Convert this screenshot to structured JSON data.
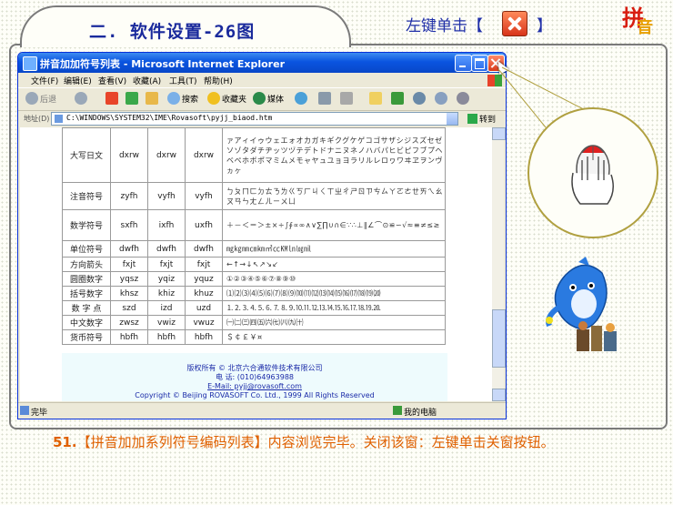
{
  "header": {
    "title": "二. 软件设置-26图",
    "hint_prefix": "左键单击【",
    "hint_suffix": "】",
    "logo_char_1": "拼",
    "logo_char_2": "音"
  },
  "browser": {
    "title": "拼音加加符号列表 - Microsoft Internet Explorer",
    "menu": [
      "文件(F)",
      "编辑(E)",
      "查看(V)",
      "收藏(A)",
      "工具(T)",
      "帮助(H)"
    ],
    "toolbar": {
      "back": "后退",
      "search": "搜索",
      "favorites": "收藏夹",
      "media": "媒体"
    },
    "address_label": "地址(D)",
    "address_value": "C:\\WINDOWS\\SYSTEM32\\IME\\Rovasoft\\pyjj_biaod.htm",
    "go_label": "转到",
    "status_text": "完毕",
    "status_zone": "我的电脑"
  },
  "table": {
    "rows": [
      {
        "name": "大写日文",
        "c1": "dxrw",
        "c2": "dxrw",
        "c3": "dxrw",
        "sym": "ァアィイゥウェエォオカガキギクグケゲコゴサザシジスズセゼソゾタダチヂッツヅテデトドナニヌネノハバパヒビピフブプヘベペホボポマミムメモャヤュユョヨラリルレロヮワヰヱヲンヴヵヶ"
      },
      {
        "name": "注音符号",
        "c1": "zyfh",
        "c2": "vyfh",
        "c3": "vyfh",
        "sym": "ㄅㄆㄇㄈㄉㄊㄋㄌㄍㄎㄏㄐㄑㄒㄓㄔㄕㄖㄗㄘㄙㄚㄛㄜㄝㄞㄟㄠㄡㄢㄣㄤㄥㄦㄧㄨㄩ"
      },
      {
        "name": "数学符号",
        "c1": "sxfh",
        "c2": "ixfh",
        "c3": "uxfh",
        "sym": "＋－＜＝＞±×÷∫∮∝∞∧∨∑∏∪∩∈∵∴⊥∥∠⌒⊙≌∽√≈≡≠≤≥"
      },
      {
        "name": "单位符号",
        "c1": "dwfh",
        "c2": "dwfh",
        "c3": "dwfh",
        "sym": "㎎㎏㎜㎝㎞㎡㏄㏎㏑㏒㏕"
      },
      {
        "name": "方向箭头",
        "c1": "fxjt",
        "c2": "fxjt",
        "c3": "fxjt",
        "sym": "←↑→↓↖↗↘↙"
      },
      {
        "name": "圆圈数字",
        "c1": "yqsz",
        "c2": "yqiz",
        "c3": "yquz",
        "sym": "①②③④⑤⑥⑦⑧⑨⑩"
      },
      {
        "name": "括号数字",
        "c1": "khsz",
        "c2": "khiz",
        "c3": "khuz",
        "sym": "⑴⑵⑶⑷⑸⑹⑺⑻⑼⑽⑾⑿⒀⒁⒂⒃⒄⒅⒆⒇"
      },
      {
        "name": "数 字 点",
        "c1": "szd",
        "c2": "izd",
        "c3": "uzd",
        "sym": "⒈⒉⒊⒋⒌⒍⒎⒏⒐⒑⒒⒓⒔⒕⒖⒗⒘⒙⒚⒛"
      },
      {
        "name": "中文数字",
        "c1": "zwsz",
        "c2": "vwiz",
        "c3": "vwuz",
        "sym": "㈠㈡㈢㈣㈤㈥㈦㈧㈨㈩"
      },
      {
        "name": "货币符号",
        "c1": "hbfh",
        "c2": "hbfh",
        "c3": "hbfh",
        "sym": "＄￠￡￥¤"
      }
    ]
  },
  "footer": {
    "line1": "版权所有 © 北京六合通软件技术有限公司",
    "line2": "电  话: (010)64963988",
    "line3": "E-Mail: pyjj@rovasoft.com",
    "line4": "Copyright © Beijing ROVASOFT Co. Ltd., 1999  All Rights Reserved"
  },
  "caption": {
    "number": "51.",
    "text": "【拼音加加系列符号编码列表】内容浏览完毕。关闭该窗：左键单击关窗按钮。"
  },
  "colors": {
    "title_blue": "#1a2a9c",
    "caption_orange": "#e06000",
    "xp_blue": "#0a54e0"
  }
}
